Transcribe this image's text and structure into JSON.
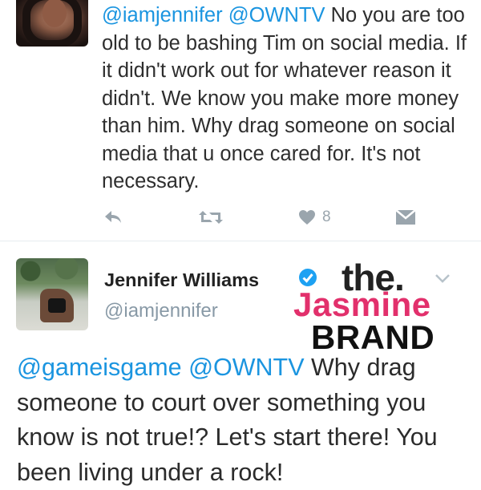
{
  "tweet1": {
    "body": [
      {
        "text": "@iamjennifer",
        "kind": "mention"
      },
      {
        "text": " ",
        "kind": "text"
      },
      {
        "text": "@OWNTV",
        "kind": "mention"
      },
      {
        "text": " No you are too old to be bashing Tim on social media. If it didn't work out for whatever reason it didn't. We know you make more money than him. Why drag someone on social media that u once cared for. It's not necessary.",
        "kind": "text"
      }
    ],
    "actions": {
      "reply_icon": "reply-icon",
      "retweet_icon": "retweet-icon",
      "like_icon": "heart-icon",
      "like_count": "8",
      "message_icon": "direct-message-icon"
    }
  },
  "tweet2": {
    "author": {
      "name": "Jennifer Williams",
      "handle": "@iamjennifer",
      "verified_icon": "verified-badge-icon"
    },
    "menu_icon": "chevron-down-icon",
    "body": [
      {
        "text": "@gameisgame",
        "kind": "mention"
      },
      {
        "text": " ",
        "kind": "text"
      },
      {
        "text": "@OWNTV",
        "kind": "mention"
      },
      {
        "text": " Why drag someone to court over something you know is not true!? Let's start there! You been living under a rock!",
        "kind": "text"
      }
    ]
  },
  "watermark": {
    "line1": "the.",
    "line2": "Jasmine",
    "line3": "BRAND"
  },
  "colors": {
    "mention": "#1b95e0",
    "icon_gray": "#9aa5ad",
    "handle_gray": "#8899a6",
    "watermark_pink": "#e2306c",
    "verified_blue": "#1da1f2"
  }
}
